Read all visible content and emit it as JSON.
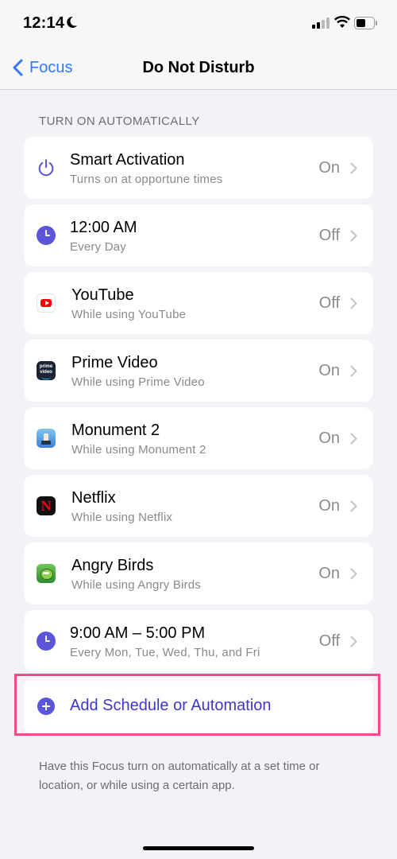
{
  "status": {
    "time": "12:14"
  },
  "nav": {
    "back_label": "Focus",
    "title": "Do Not Disturb"
  },
  "section_header": "TURN ON AUTOMATICALLY",
  "rows": [
    {
      "title": "Smart Activation",
      "subtitle": "Turns on at opportune times",
      "value": "On",
      "icon": "power-icon"
    },
    {
      "title": "12:00 AM",
      "subtitle": "Every Day",
      "value": "Off",
      "icon": "clock-icon"
    },
    {
      "title": "YouTube",
      "subtitle": "While using YouTube",
      "value": "Off",
      "icon": "youtube-app-icon"
    },
    {
      "title": "Prime Video",
      "subtitle": "While using Prime Video",
      "value": "On",
      "icon": "prime-video-app-icon",
      "icon_text": "prime video"
    },
    {
      "title": "Monument 2",
      "subtitle": "While using Monument 2",
      "value": "On",
      "icon": "monument-2-app-icon"
    },
    {
      "title": "Netflix",
      "subtitle": "While using Netflix",
      "value": "On",
      "icon": "netflix-app-icon",
      "icon_text": "N"
    },
    {
      "title": "Angry Birds",
      "subtitle": "While using Angry Birds",
      "value": "On",
      "icon": "angry-birds-app-icon"
    },
    {
      "title": "9:00 AM – 5:00 PM",
      "subtitle": "Every Mon, Tue, Wed, Thu, and Fri",
      "value": "Off",
      "icon": "clock-icon"
    }
  ],
  "add_button": {
    "label": "Add Schedule or Automation",
    "icon": "plus-circle-icon"
  },
  "footer_text": "Have this Focus turn on automatically at a set time or location, or while using a certain app.",
  "colors": {
    "accent": "#5a55d9",
    "link": "#3478f6",
    "highlight": "#ef4b8c",
    "background": "#f2f2f7"
  }
}
